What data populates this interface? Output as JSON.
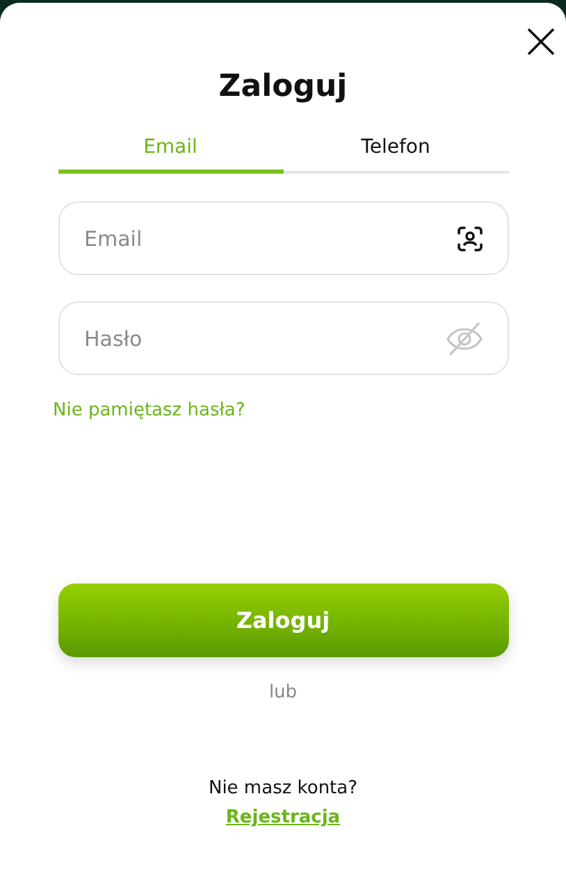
{
  "title": "Zaloguj",
  "tabs": [
    {
      "label": "Email",
      "selected": true
    },
    {
      "label": "Telefon",
      "selected": false
    }
  ],
  "fields": [
    {
      "placeholder": "Email",
      "kind": "email"
    },
    {
      "placeholder": "Hasło",
      "kind": "password"
    }
  ],
  "forgot_link": "Nie pamiętasz hasła?",
  "submit_button": "Zaloguj",
  "separator": "lub",
  "signup_prompt": "Nie masz konta?",
  "signup_link": "Rejestracja"
}
